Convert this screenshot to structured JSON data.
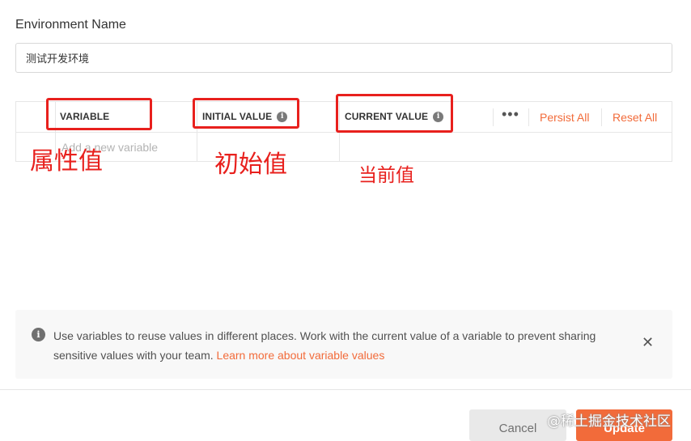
{
  "form": {
    "env_label": "Environment Name",
    "env_value": "测试开发环境"
  },
  "table": {
    "col_variable": "VARIABLE",
    "col_initial": "INITIAL VALUE",
    "col_current": "CURRENT VALUE",
    "more_icon": "more-horizontal-icon",
    "persist_all": "Persist All",
    "reset_all": "Reset All",
    "new_row_placeholder": "Add a new variable"
  },
  "annotations": {
    "variable_note": "属性值",
    "initial_note": "初始值",
    "current_note": "当前值",
    "color": "#e8201d"
  },
  "banner": {
    "icon": "info-icon",
    "text": "Use variables to reuse values in different places. Work with the current value of a variable to prevent sharing sensitive values with your team.",
    "link": "Learn more about variable values",
    "close_icon": "close-icon"
  },
  "footer": {
    "cancel_label": "Cancel",
    "update_label": "Update"
  },
  "watermark": "@稀土掘金技术社区",
  "colors": {
    "accent": "#f26b3a",
    "annotation": "#e8201d"
  }
}
